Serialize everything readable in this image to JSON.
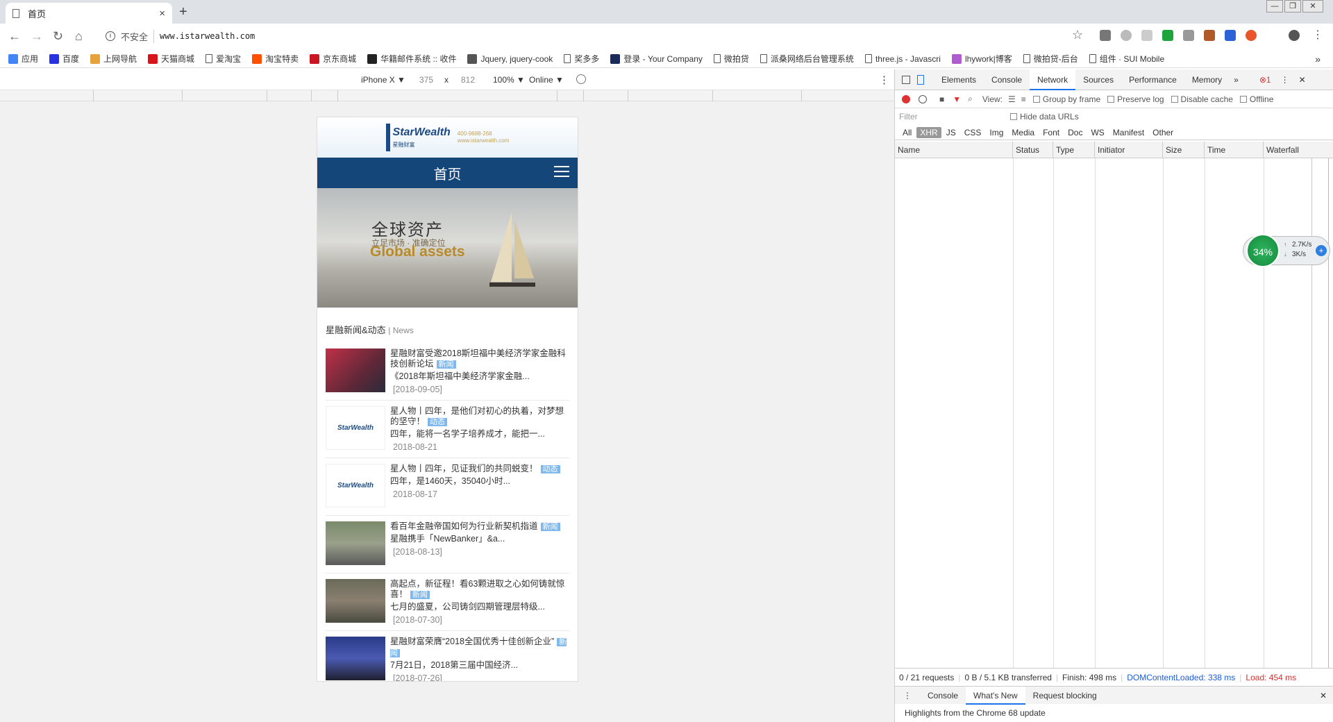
{
  "browser": {
    "tab_title": "首页",
    "tab_close": "×",
    "new_tab": "+",
    "insecure_label": "不安全",
    "url": "www.istarwealth.com",
    "bookmarks": [
      {
        "label": "应用",
        "color": "#4285f4"
      },
      {
        "label": "百度",
        "color": "#2932e1"
      },
      {
        "label": "上网导航",
        "color": "#e7a33b"
      },
      {
        "label": "天猫商城",
        "color": "#d7151a"
      },
      {
        "label": "爱淘宝",
        "color": null
      },
      {
        "label": "淘宝特卖",
        "color": "#ff5000"
      },
      {
        "label": "京东商城",
        "color": "#c91623"
      },
      {
        "label": "华籍邮件系统 :: 收件",
        "color": "#222222"
      },
      {
        "label": "Jquery, jquery-cook",
        "color": "#555555"
      },
      {
        "label": "奖多多",
        "color": null
      },
      {
        "label": "登录 - Your Company",
        "color": "#1a2a5a"
      },
      {
        "label": "微拍贷",
        "color": null
      },
      {
        "label": "派桑网络后台管理系统",
        "color": null
      },
      {
        "label": "three.js - Javascri",
        "color": null
      },
      {
        "label": "lhywork|博客",
        "color": "#b05bd0"
      },
      {
        "label": "微拍贷-后台",
        "color": null
      },
      {
        "label": "组件 · SUI Mobile",
        "color": null
      }
    ],
    "bookmarks_more": "»"
  },
  "device_toolbar": {
    "device": "iPhone X ▼",
    "width": "375",
    "times": "x",
    "height": "812",
    "zoom": "100% ▼",
    "network": "Online ▼"
  },
  "mobile_page": {
    "logo_name": "StarWealth",
    "logo_cn": "星融财富",
    "logo_phone": "400-9688-268",
    "logo_site": "www.istarwealth.com",
    "nav_title": "首页",
    "banner_cn": "全球资产",
    "banner_sub": "立足市场 · 准确定位",
    "banner_en": "Global assets",
    "news_title": "星融新闻&动态",
    "news_title_en": "| News",
    "news": [
      {
        "title": "星融财富受邀2018斯坦福中美经济学家金融科技创新论坛",
        "tag": "新闻",
        "summary": "《2018年斯坦福中美经济学家金融...",
        "date": "[2018-09-05]",
        "thumb": "photo-red"
      },
      {
        "title": "星人物丨四年，是他们对初心的执着，对梦想的坚守！",
        "tag": "动态",
        "summary": "四年，能将一名学子培养成才，能把一...",
        "date": "2018-08-21",
        "thumb": "logo"
      },
      {
        "title": "星人物丨四年，见证我们的共同蜕变！",
        "tag": "动态",
        "summary": "四年，是1460天，35040小时...",
        "date": "2018-08-17",
        "thumb": "logo"
      },
      {
        "title": "看百年金融帝国如何为行业新契机指道",
        "tag": "新闻",
        "summary": "星融携手「NewBanker」&a...",
        "date": "[2018-08-13]",
        "thumb": "photo-group"
      },
      {
        "title": "高起点，新征程！看63颗进取之心如何铸就惊喜！",
        "tag": "新闻",
        "summary": "七月的盛夏，公司铸剑四期管理层特级...",
        "date": "[2018-07-30]",
        "thumb": "photo-meeting"
      },
      {
        "title": "星融财富荣膺“2018全国优秀十佳创新企业”",
        "tag": "新闻",
        "summary": "7月21日，2018第三届中国经济...",
        "date": "[2018-07-26]",
        "thumb": "photo-stage"
      }
    ]
  },
  "devtools": {
    "tabs": [
      "Elements",
      "Console",
      "Network",
      "Sources",
      "Performance",
      "Memory"
    ],
    "active_tab": "Network",
    "more_tabs": "»",
    "error_count": "1",
    "view_label": "View:",
    "group_by_frame": "Group by frame",
    "preserve_log": "Preserve log",
    "disable_cache": "Disable cache",
    "offline": "Offline",
    "filter_placeholder": "Filter",
    "hide_data_urls": "Hide data URLs",
    "types": [
      "All",
      "XHR",
      "JS",
      "CSS",
      "Img",
      "Media",
      "Font",
      "Doc",
      "WS",
      "Manifest",
      "Other"
    ],
    "active_type": "XHR",
    "columns": [
      "Name",
      "Status",
      "Type",
      "Initiator",
      "Size",
      "Time",
      "Waterfall"
    ],
    "status": {
      "requests": "0 / 21 requests",
      "transferred": "0 B / 5.1 KB transferred",
      "finish": "Finish: 498 ms",
      "dcl": "DOMContentLoaded: 338 ms",
      "load": "Load: 454 ms"
    },
    "drawer_tabs": [
      "Console",
      "What's New",
      "Request blocking"
    ],
    "drawer_active": "What's New",
    "drawer_content": "Highlights from the Chrome 68 update"
  },
  "speed_widget": {
    "percent": "34%",
    "up": "2.7K/s",
    "down": "3K/s"
  },
  "colors": {
    "nav_blue": "#144679",
    "tag_blue": "#7fb8ec",
    "devtools_active": "#1a73e8",
    "dcl_color": "#1a5bd8",
    "load_color": "#d33030"
  }
}
